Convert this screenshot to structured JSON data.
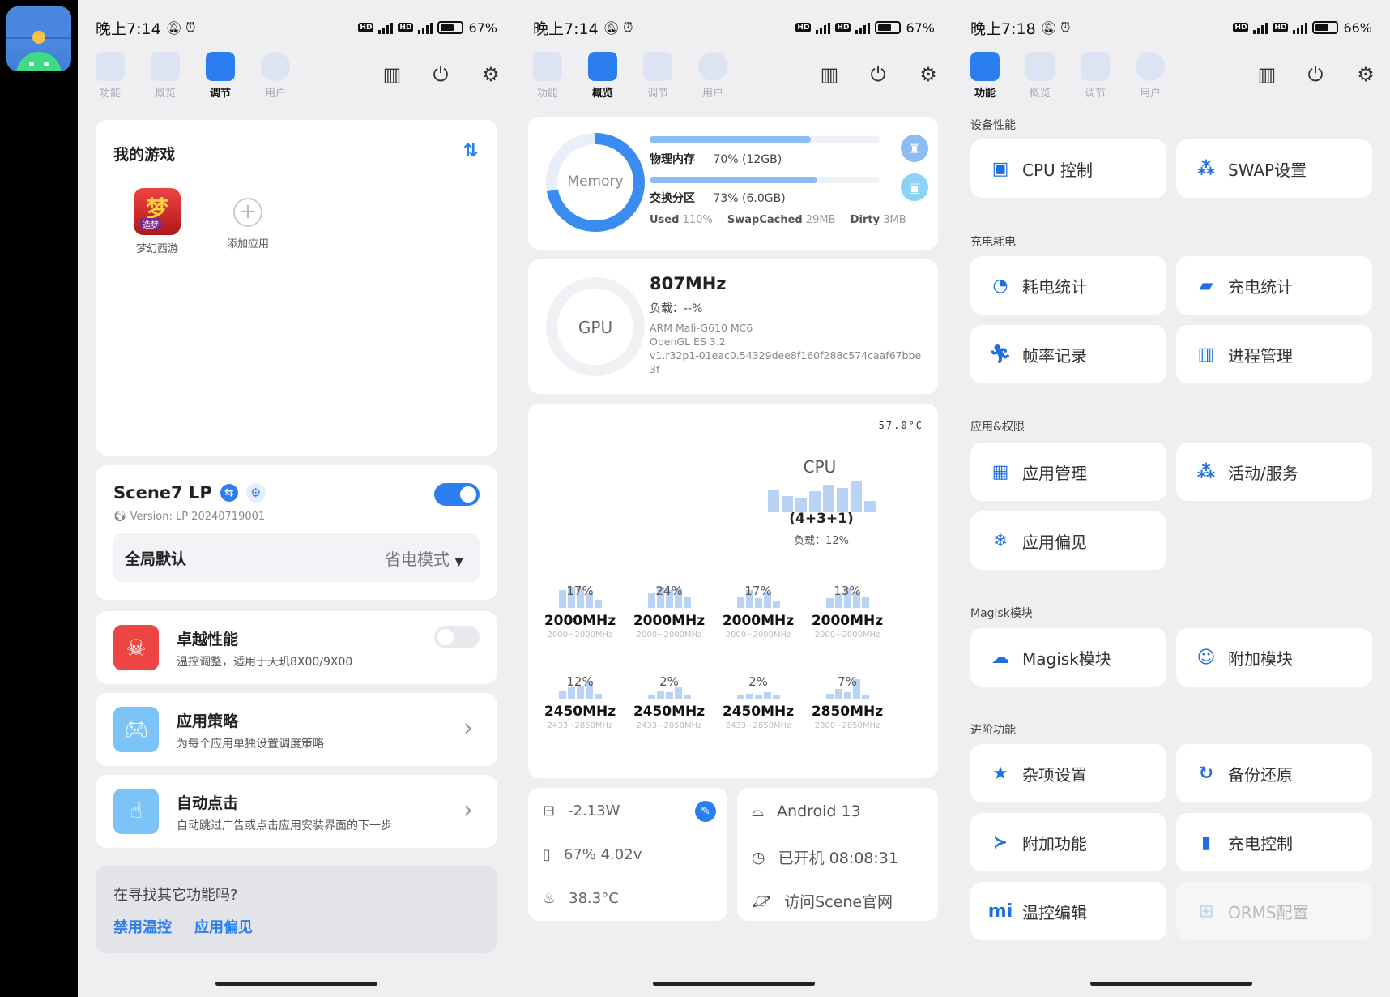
{
  "statusbar": [
    {
      "time": "晚上7:14",
      "battery": "67%",
      "battery_level": 0.67
    },
    {
      "time": "晚上7:14",
      "battery": "67%",
      "battery_level": 0.67
    },
    {
      "time": "晚上7:18",
      "battery": "66%",
      "battery_level": 0.66
    }
  ],
  "nav": {
    "tabs": [
      "功能",
      "概览",
      "调节",
      "用户"
    ]
  },
  "screen1": {
    "my_games": {
      "title": "我的游戏",
      "apps": [
        {
          "label": "梦幻西游"
        },
        {
          "label": "添加应用"
        }
      ],
      "app_icon_text": "梦",
      "app_icon_sub": "造梦"
    },
    "scene": {
      "title": "Scene7 LP",
      "version": "Version: LP 20240719001",
      "enabled": true,
      "mode_label": "全局默认",
      "mode_value": "省电模式"
    },
    "items": [
      {
        "title": "卓越性能",
        "desc": "温控调整，适用于天玑8X00/9X00",
        "toggle": false,
        "color": "#ef4444"
      },
      {
        "title": "应用策略",
        "desc": "为每个应用单独设置调度策略",
        "color": "#7cc4f7"
      },
      {
        "title": "自动点击",
        "desc": "自动跳过广告或点击应用安装界面的下一步",
        "color": "#7cc4f7"
      }
    ],
    "footer": {
      "question": "在寻找其它功能吗?",
      "links": [
        "禁用温控",
        "应用偏见"
      ]
    }
  },
  "screen2": {
    "memory": {
      "ring_label": "Memory",
      "ring_fraction": 0.72,
      "physical_label": "物理内存",
      "physical_value": "70% (12GB)",
      "physical_fraction": 0.7,
      "swap_label": "交换分区",
      "swap_value": "73% (6.0GB)",
      "swap_fraction": 0.73,
      "used_label": "Used",
      "used_value": "110%",
      "swapcached_label": "SwapCached",
      "swapcached_value": "29MB",
      "dirty_label": "Dirty",
      "dirty_value": "3MB"
    },
    "gpu": {
      "ring_label": "GPU",
      "freq": "807MHz",
      "load": "负载：--%",
      "model": "ARM Mali-G610 MC6",
      "gl": "OpenGL ES 3.2",
      "driver": "v1.r32p1-01eac0.54329dee8f160f288c574caaf67bbe3f"
    },
    "cpu": {
      "temp": "57.0°C",
      "label": "CPU",
      "cluster": "(4+3+1)",
      "load": "负载：12%",
      "cores": [
        {
          "pct": "17%",
          "freq": "2000MHz",
          "range": "2000~2000MHz"
        },
        {
          "pct": "24%",
          "freq": "2000MHz",
          "range": "2000~2000MHz"
        },
        {
          "pct": "17%",
          "freq": "2000MHz",
          "range": "2000~2000MHz"
        },
        {
          "pct": "13%",
          "freq": "2000MHz",
          "range": "2000~2000MHz"
        },
        {
          "pct": "12%",
          "freq": "2450MHz",
          "range": "2433~2850MHz"
        },
        {
          "pct": "2%",
          "freq": "2450MHz",
          "range": "2433~2850MHz"
        },
        {
          "pct": "2%",
          "freq": "2450MHz",
          "range": "2433~2850MHz"
        },
        {
          "pct": "7%",
          "freq": "2850MHz",
          "range": "2800~2850MHz"
        }
      ]
    },
    "battery": {
      "power": "-2.13W",
      "level": "67%  4.02v",
      "temp": "38.3°C"
    },
    "system": {
      "android": "Android 13",
      "uptime": "已开机  08:08:31",
      "site": "访问Scene官网"
    }
  },
  "screen3": {
    "sections": [
      {
        "title": "设备性能",
        "items": [
          "CPU 控制",
          "SWAP设置"
        ]
      },
      {
        "title": "充电耗电",
        "items": [
          "耗电统计",
          "充电统计",
          "帧率记录",
          "进程管理"
        ]
      },
      {
        "title": "应用&权限",
        "items": [
          "应用管理",
          "活动/服务",
          "应用偏见"
        ]
      },
      {
        "title": "Magisk模块",
        "items": [
          "Magisk模块",
          "附加模块"
        ]
      },
      {
        "title": "进阶功能",
        "items": [
          "杂项设置",
          "备份还原",
          "附加功能",
          "充电控制",
          "温控编辑",
          "ORMS配置"
        ]
      }
    ]
  }
}
